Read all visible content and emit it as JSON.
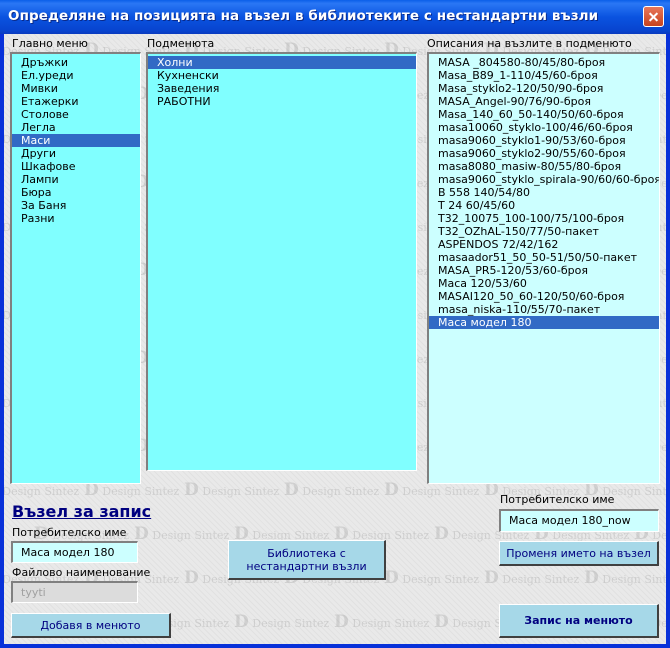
{
  "window": {
    "title": "Определяне на позицията на възел в библиотеките с нестандартни възли",
    "watermark_big": "D",
    "watermark_line1": "Design",
    "watermark_line2": "Sintez"
  },
  "main_menu": {
    "label": "Главно меню",
    "items": [
      "Дръжки",
      "Ел.уреди",
      "Мивки",
      "Етажерки",
      "Столове",
      "Легла",
      "Маси",
      "Други",
      "Шкафове",
      "Лампи",
      "Бюра",
      "За Баня",
      "Разни"
    ],
    "selected": "Маси"
  },
  "submenu": {
    "label": "Подменюта",
    "items": [
      "Холни",
      "Кухненски",
      "Заведения",
      "РАБОТНИ"
    ],
    "selected": "Холни"
  },
  "descriptions": {
    "label": "Описания на възлите в подменюто",
    "items": [
      "MASA _804580-80/45/80-броя",
      "Masa_B89_1-110/45/60-броя",
      "Masa_styklo2-120/50/90-броя",
      "MASA_Angel-90/76/90-броя",
      "Masa_140_60_50-140/50/60-броя",
      "masa10060_styklo-100/46/60-броя",
      "masa9060_styklo1-90/53/60-броя",
      "masa9060_styklo2-90/55/60-броя",
      "masa8080_masiw-80/55/80-броя",
      "masa9060_styklo_spirala-90/60/60-броя",
      "B 558 140/54/80",
      "T 24 60/45/60",
      "T32_10075_100-100/75/100-броя",
      "T32_OZhAL-150/77/50-пакет",
      "ASPENDOS 72/42/162",
      "masaador51_50_50-51/50/50-пакет",
      "MASA_PR5-120/53/60-броя",
      "Маса 120/53/60",
      "MASAI120_50_60-120/50/60-броя",
      "masa_niska-110/55/70-пакет",
      "Маса модел 180"
    ],
    "selected": "Маса модел 180"
  },
  "record_node": {
    "heading": "Възел за запис",
    "username_label": "Потребителско име",
    "username_value": "Маса модел 180",
    "filename_label": "Файлово наименование",
    "filename_value": "tyyti"
  },
  "right_panel": {
    "username_label": "Потребителско име",
    "username_value": "Маса модел 180_now"
  },
  "buttons": {
    "library": "Библиотека с нестандартни възли",
    "rename": "Променя името на възел",
    "add_to_menu": "Добавя в менюто",
    "save_menu": "Запис на менюто"
  }
}
